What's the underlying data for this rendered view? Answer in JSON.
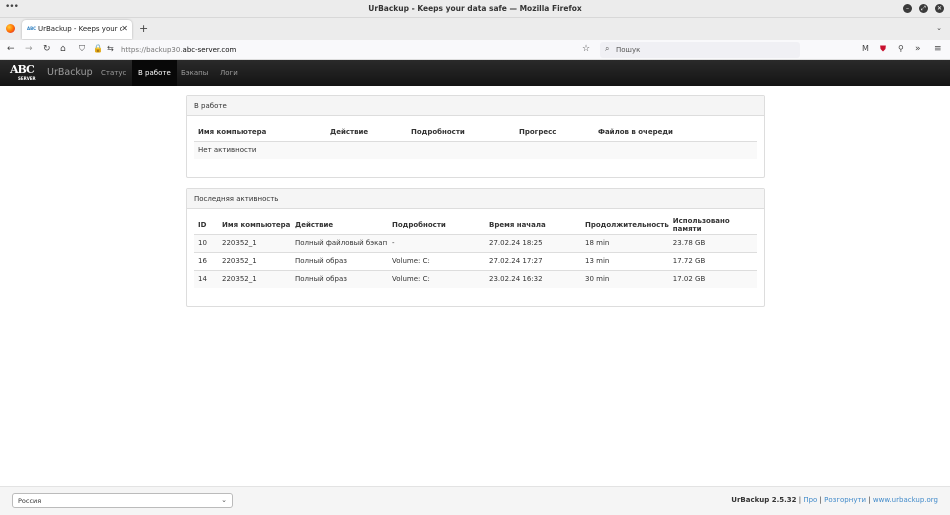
{
  "window": {
    "title": "UrBackup - Keeps your data safe — Mozilla Firefox"
  },
  "browser": {
    "tab_title": "UrBackup - Keeps your data",
    "favicon_text": "ABC",
    "url_prefix": "https://backup30.",
    "url_domain": "abc-server.com",
    "search_placeholder": "Пошук"
  },
  "app": {
    "logo_text": "ABC",
    "logo_sub": "SERVER",
    "brand": "UrBackup",
    "nav": [
      {
        "label": "Статус",
        "active": false
      },
      {
        "label": "В работе",
        "active": true
      },
      {
        "label": "Бэкапы",
        "active": false
      },
      {
        "label": "Логи",
        "active": false
      }
    ]
  },
  "in_progress": {
    "title": "В работе",
    "columns": [
      "Имя компьютера",
      "Действие",
      "Подробности",
      "Прогресс",
      "Файлов в очереди"
    ],
    "empty_text": "Нет активности"
  },
  "recent": {
    "title": "Последняя активность",
    "columns": [
      "ID",
      "Имя компьютера",
      "Действие",
      "Подробности",
      "Время начала",
      "Продолжительность",
      "Использовано памяти"
    ],
    "rows": [
      [
        "10",
        "220352_1",
        "Полный файловый бэкап",
        "-",
        "27.02.24 18:25",
        "18 min",
        "23.78 GB"
      ],
      [
        "16",
        "220352_1",
        "Полный образ",
        "Volume: C:",
        "27.02.24 17:27",
        "13 min",
        "17.72 GB"
      ],
      [
        "14",
        "220352_1",
        "Полный образ",
        "Volume: C:",
        "23.02.24 16:32",
        "30 min",
        "17.02 GB"
      ]
    ]
  },
  "footer": {
    "language": "Россия",
    "version": "UrBackup 2.5.32",
    "sep1": " | ",
    "link_pro": "Про",
    "sep2": " | ",
    "link_donate": "Розгорнути",
    "sep3": " | ",
    "link_site": "www.urbackup.org"
  }
}
